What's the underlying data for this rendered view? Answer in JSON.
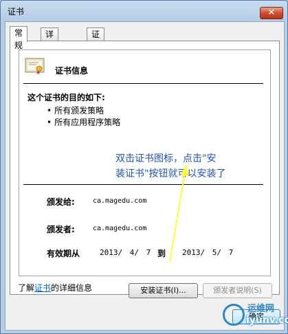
{
  "window": {
    "title": "证书",
    "close_label": "✕"
  },
  "tabs": [
    {
      "label": "常规",
      "active": true
    },
    {
      "label": "详细信息",
      "active": false
    },
    {
      "label": "证书路径",
      "active": false
    }
  ],
  "cert": {
    "icon": "certificate-icon",
    "title": "证书信息",
    "purpose_heading": "这个证书的目的如下:",
    "purposes": [
      "所有颁发策略",
      "所有应用程序策略"
    ],
    "issued_to_label": "颁发给:",
    "issued_to_value": "ca.magedu.com",
    "issued_by_label": "颁发者:",
    "issued_by_value": "ca.magedu.com",
    "valid_label": "有效期从",
    "valid_from": "2013/ 4/ 7",
    "valid_to_word": "到",
    "valid_to": "2013/ 5/ 7"
  },
  "annotation": {
    "line1": "双击证书图标，点击\"安",
    "line2": "装证书\"按钮就可以安装了",
    "color": "#2452a8"
  },
  "buttons": {
    "install": "安装证书(I)...",
    "issuer_statement": "颁发者说明(S)",
    "ok": "确定"
  },
  "learn_more": {
    "prefix": "了解",
    "link": "证书",
    "suffix": "的详细信息"
  },
  "watermark": {
    "cn": "运维网",
    "en": "iyunv.com"
  }
}
